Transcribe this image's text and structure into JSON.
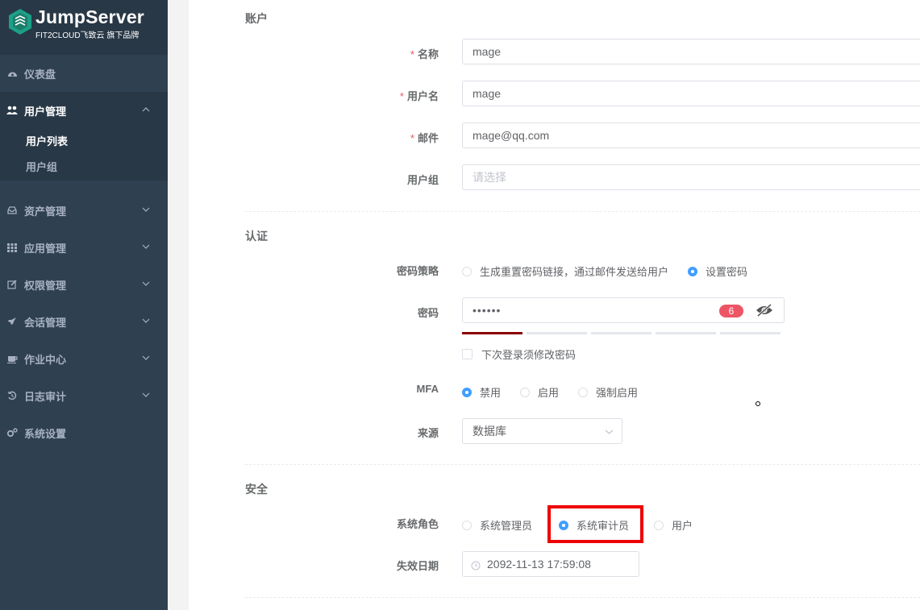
{
  "brand": {
    "title": "JumpServer",
    "subtitle": "FIT2CLOUD飞致云 旗下品牌"
  },
  "sidebar": {
    "items": [
      {
        "label": "仪表盘",
        "icon": "dashboard-icon"
      },
      {
        "label": "用户管理",
        "icon": "users-icon",
        "expanded": true,
        "children": [
          {
            "label": "用户列表",
            "current": true
          },
          {
            "label": "用户组",
            "current": false
          }
        ]
      },
      {
        "label": "资产管理",
        "icon": "inbox-icon"
      },
      {
        "label": "应用管理",
        "icon": "grid-icon"
      },
      {
        "label": "权限管理",
        "icon": "edit-icon"
      },
      {
        "label": "会话管理",
        "icon": "rocket-icon"
      },
      {
        "label": "作业中心",
        "icon": "coffee-icon"
      },
      {
        "label": "日志审计",
        "icon": "history-icon"
      },
      {
        "label": "系统设置",
        "icon": "gears-icon"
      }
    ]
  },
  "account": {
    "title": "账户",
    "name_label": "名称",
    "name_value": "mage",
    "username_label": "用户名",
    "username_value": "mage",
    "email_label": "邮件",
    "email_value": "mage@qq.com",
    "group_label": "用户组",
    "group_placeholder": "请选择"
  },
  "auth": {
    "title": "认证",
    "policy_label": "密码策略",
    "policy_options": [
      "生成重置密码链接，通过邮件发送给用户",
      "设置密码"
    ],
    "policy_selected": "设置密码",
    "password_label": "密码",
    "password_value": "••••••",
    "password_length": "6",
    "strength_segments": 5,
    "strength_level": 1,
    "must_change_label": "下次登录须修改密码",
    "mfa_label": "MFA",
    "mfa_options": [
      "禁用",
      "启用",
      "强制启用"
    ],
    "mfa_selected": "禁用",
    "source_label": "来源",
    "source_value": "数据库"
  },
  "security": {
    "title": "安全",
    "role_label": "系统角色",
    "role_options": [
      "系统管理员",
      "系统审计员",
      "用户"
    ],
    "role_selected": "系统审计员",
    "expire_label": "失效日期",
    "expire_value": "2092-11-13 17:59:08"
  },
  "colors": {
    "sidebar_bg": "#2f4050",
    "accent": "#409eff",
    "highlight": "#ee0000",
    "badge": "#ed5565",
    "strength_fill": "#8b0000"
  }
}
